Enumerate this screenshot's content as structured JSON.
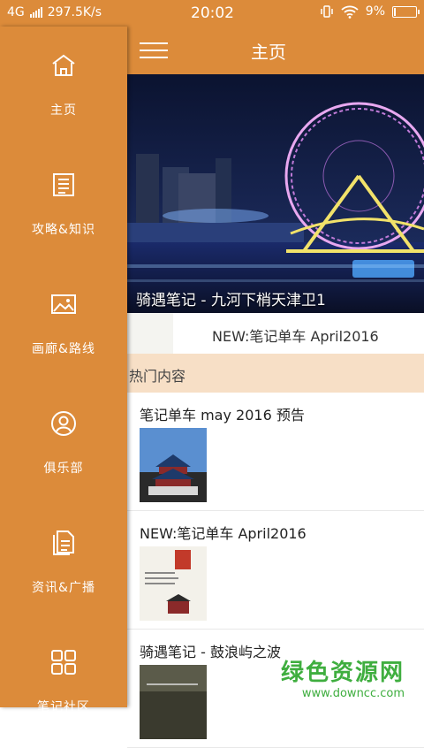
{
  "status": {
    "network": "4G",
    "speed": "297.5K/s",
    "time": "20:02",
    "battery": "9%",
    "battery_level": 0.09
  },
  "drawer": {
    "items": [
      {
        "label": "主页",
        "icon": "home-icon"
      },
      {
        "label": "攻略&知识",
        "icon": "book-icon"
      },
      {
        "label": "画廊&路线",
        "icon": "picture-icon"
      },
      {
        "label": "俱乐部",
        "icon": "user-icon"
      },
      {
        "label": "资讯&广播",
        "icon": "document-icon"
      },
      {
        "label": "笔记社区",
        "icon": "grid-icon"
      }
    ]
  },
  "appbar": {
    "title": "主页"
  },
  "banner": {
    "caption": "骑遇笔记 - 九河下梢天津卫1"
  },
  "headline": {
    "text": "NEW:笔记单车 April2016"
  },
  "section": {
    "title": "热门内容"
  },
  "cards": [
    {
      "title": "笔记单车 may 2016 预告"
    },
    {
      "title": "NEW:笔记单车 April2016"
    },
    {
      "title": "骑遇笔记 - 鼓浪屿之波"
    }
  ],
  "watermark": {
    "main": "绿色资源网",
    "url": "www.downcc.com"
  },
  "colors": {
    "accent": "#dc8b3a",
    "section_bg": "#f7dfc6"
  }
}
